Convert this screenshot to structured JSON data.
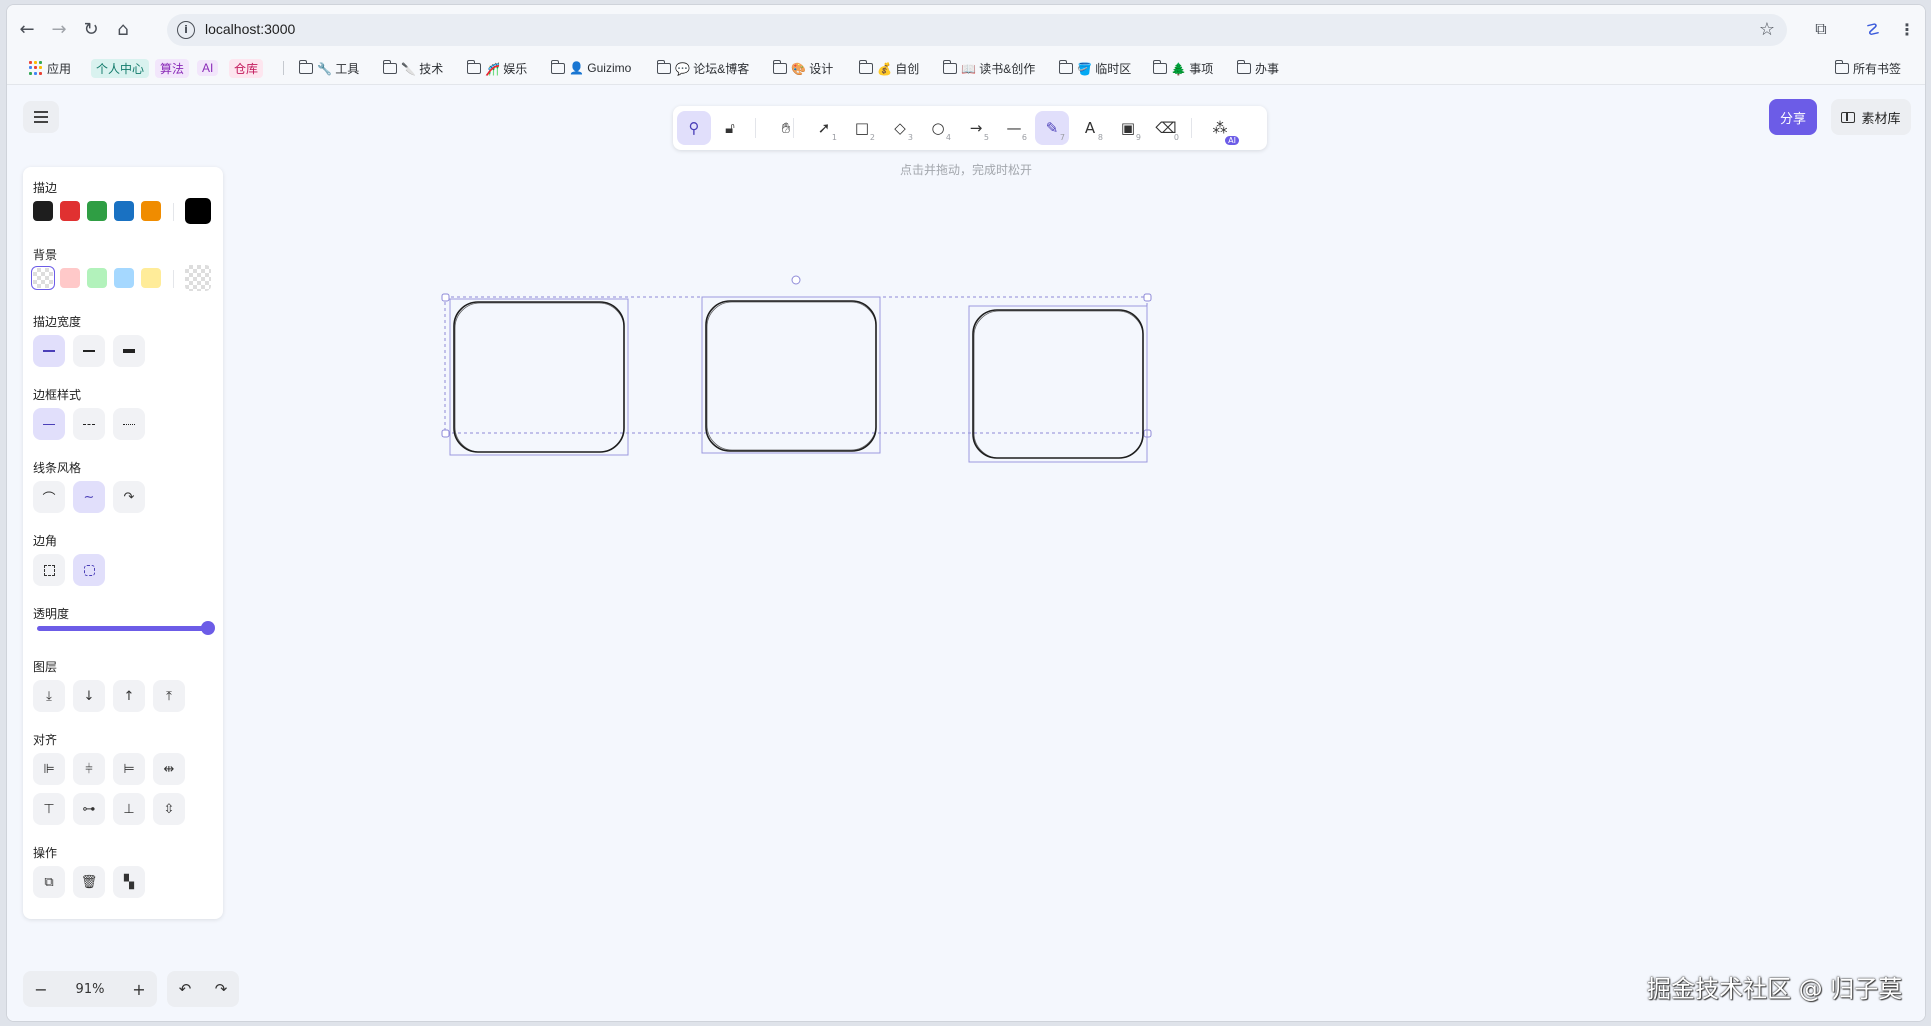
{
  "browser": {
    "url": "localhost:3000",
    "bookmarks": [
      {
        "label": "应用",
        "type": "apps"
      },
      {
        "label": "个人中心",
        "type": "tag",
        "bg": "#d9f2ef",
        "fg": "#137a6b"
      },
      {
        "label": "算法",
        "type": "tag",
        "bg": "#f2e6fb",
        "fg": "#8a2bb8"
      },
      {
        "label": "AI",
        "type": "tag",
        "bg": "#f2e6fb",
        "fg": "#8a2bb8"
      },
      {
        "label": "仓库",
        "type": "tag",
        "bg": "#fde6ef",
        "fg": "#c2185b"
      },
      {
        "label": "🔧 工具",
        "type": "folder"
      },
      {
        "label": "🔪 技术",
        "type": "folder"
      },
      {
        "label": "🎢 娱乐",
        "type": "folder"
      },
      {
        "label": "👤 Guizimo",
        "type": "folder"
      },
      {
        "label": "💬 论坛&博客",
        "type": "folder"
      },
      {
        "label": "🎨 设计",
        "type": "folder"
      },
      {
        "label": "💰 自创",
        "type": "folder"
      },
      {
        "label": "📖 读书&创作",
        "type": "folder"
      },
      {
        "label": "🪣 临时区",
        "type": "folder"
      },
      {
        "label": "🌲 事项",
        "type": "folder"
      },
      {
        "label": "办事",
        "type": "folder"
      }
    ],
    "all_bookmarks": "所有书签"
  },
  "toolbar": {
    "tools": [
      {
        "name": "lock-tool",
        "icon": "pin-icon",
        "glyph": "⚲",
        "key": "",
        "active": true
      },
      {
        "name": "unlock-tool",
        "icon": "lock-icon",
        "glyph": "🔓︎",
        "key": "",
        "active": false
      },
      {
        "name": "hand-tool",
        "icon": "hand-icon",
        "glyph": "✋︎",
        "key": "",
        "active": false
      },
      {
        "name": "select-tool",
        "icon": "cursor-icon",
        "glyph": "➚",
        "key": "1",
        "active": false
      },
      {
        "name": "rectangle-tool",
        "icon": "rectangle-icon",
        "glyph": "□",
        "key": "2",
        "active": false
      },
      {
        "name": "diamond-tool",
        "icon": "diamond-icon",
        "glyph": "◇",
        "key": "3",
        "active": false
      },
      {
        "name": "ellipse-tool",
        "icon": "circle-icon",
        "glyph": "○",
        "key": "4",
        "active": false
      },
      {
        "name": "arrow-tool",
        "icon": "arrow-icon",
        "glyph": "→",
        "key": "5",
        "active": false
      },
      {
        "name": "line-tool",
        "icon": "line-icon",
        "glyph": "—",
        "key": "6",
        "active": false
      },
      {
        "name": "draw-tool",
        "icon": "pencil-icon",
        "glyph": "✎",
        "key": "7",
        "active": true
      },
      {
        "name": "text-tool",
        "icon": "text-icon",
        "glyph": "A",
        "key": "8",
        "active": false
      },
      {
        "name": "image-tool",
        "icon": "image-icon",
        "glyph": "▣",
        "key": "9",
        "active": false
      },
      {
        "name": "eraser-tool",
        "icon": "eraser-icon",
        "glyph": "⌫",
        "key": "0",
        "active": false
      },
      {
        "name": "ai-tool",
        "icon": "shapes-icon",
        "glyph": "⁂",
        "key": "",
        "badge": "AI",
        "active": false
      }
    ],
    "hint": "点击并拖动，完成时松开"
  },
  "header": {
    "share_label": "分享",
    "library_label": "素材库"
  },
  "panel": {
    "stroke_title": "描边",
    "stroke_colors": [
      "#1e1e1e",
      "#e03131",
      "#2f9e44",
      "#1971c2",
      "#f08c00"
    ],
    "stroke_current": "#000000",
    "bg_title": "背景",
    "bg_colors": [
      "transparent",
      "#ffc9c9",
      "#b2f2bb",
      "#a5d8ff",
      "#ffec99"
    ],
    "stroke_width_title": "描边宽度",
    "border_style_title": "边框样式",
    "line_style_title": "线条风格",
    "corner_title": "边角",
    "opacity_title": "透明度",
    "opacity_value": 100,
    "layer_title": "图层",
    "align_title": "对齐",
    "actions_title": "操作"
  },
  "zoom": {
    "value": "91%",
    "minus": "−",
    "plus": "+"
  },
  "history": {
    "undo": "↶",
    "redo": "↷"
  },
  "watermark": "掘金技术社区 @ 归子莫"
}
